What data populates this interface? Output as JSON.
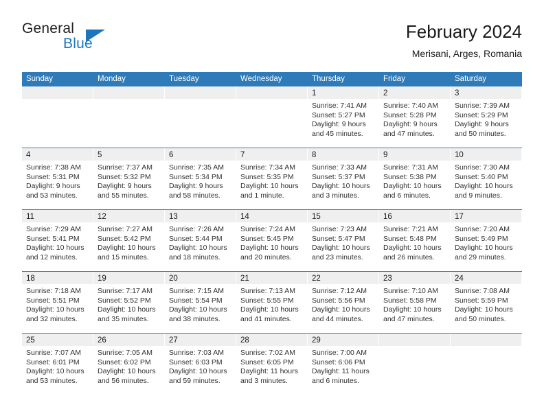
{
  "brand": {
    "name_top": "General",
    "name_bottom": "Blue",
    "triangle_icon": "blue-triangle-icon",
    "accent_color": "#1b76bc"
  },
  "header": {
    "title": "February 2024",
    "subtitle": "Merisani, Arges, Romania"
  },
  "colors": {
    "header_blue": "#2f7ab8",
    "day_head_gray": "#efeff0",
    "text": "#303030"
  },
  "weekdays": [
    "Sunday",
    "Monday",
    "Tuesday",
    "Wednesday",
    "Thursday",
    "Friday",
    "Saturday"
  ],
  "weeks": [
    [
      {
        "day": "",
        "lines": []
      },
      {
        "day": "",
        "lines": []
      },
      {
        "day": "",
        "lines": []
      },
      {
        "day": "",
        "lines": []
      },
      {
        "day": "1",
        "lines": [
          "Sunrise: 7:41 AM",
          "Sunset: 5:27 PM",
          "Daylight: 9 hours",
          "and 45 minutes."
        ]
      },
      {
        "day": "2",
        "lines": [
          "Sunrise: 7:40 AM",
          "Sunset: 5:28 PM",
          "Daylight: 9 hours",
          "and 47 minutes."
        ]
      },
      {
        "day": "3",
        "lines": [
          "Sunrise: 7:39 AM",
          "Sunset: 5:29 PM",
          "Daylight: 9 hours",
          "and 50 minutes."
        ]
      }
    ],
    [
      {
        "day": "4",
        "lines": [
          "Sunrise: 7:38 AM",
          "Sunset: 5:31 PM",
          "Daylight: 9 hours",
          "and 53 minutes."
        ]
      },
      {
        "day": "5",
        "lines": [
          "Sunrise: 7:37 AM",
          "Sunset: 5:32 PM",
          "Daylight: 9 hours",
          "and 55 minutes."
        ]
      },
      {
        "day": "6",
        "lines": [
          "Sunrise: 7:35 AM",
          "Sunset: 5:34 PM",
          "Daylight: 9 hours",
          "and 58 minutes."
        ]
      },
      {
        "day": "7",
        "lines": [
          "Sunrise: 7:34 AM",
          "Sunset: 5:35 PM",
          "Daylight: 10 hours",
          "and 1 minute."
        ]
      },
      {
        "day": "8",
        "lines": [
          "Sunrise: 7:33 AM",
          "Sunset: 5:37 PM",
          "Daylight: 10 hours",
          "and 3 minutes."
        ]
      },
      {
        "day": "9",
        "lines": [
          "Sunrise: 7:31 AM",
          "Sunset: 5:38 PM",
          "Daylight: 10 hours",
          "and 6 minutes."
        ]
      },
      {
        "day": "10",
        "lines": [
          "Sunrise: 7:30 AM",
          "Sunset: 5:40 PM",
          "Daylight: 10 hours",
          "and 9 minutes."
        ]
      }
    ],
    [
      {
        "day": "11",
        "lines": [
          "Sunrise: 7:29 AM",
          "Sunset: 5:41 PM",
          "Daylight: 10 hours",
          "and 12 minutes."
        ]
      },
      {
        "day": "12",
        "lines": [
          "Sunrise: 7:27 AM",
          "Sunset: 5:42 PM",
          "Daylight: 10 hours",
          "and 15 minutes."
        ]
      },
      {
        "day": "13",
        "lines": [
          "Sunrise: 7:26 AM",
          "Sunset: 5:44 PM",
          "Daylight: 10 hours",
          "and 18 minutes."
        ]
      },
      {
        "day": "14",
        "lines": [
          "Sunrise: 7:24 AM",
          "Sunset: 5:45 PM",
          "Daylight: 10 hours",
          "and 20 minutes."
        ]
      },
      {
        "day": "15",
        "lines": [
          "Sunrise: 7:23 AM",
          "Sunset: 5:47 PM",
          "Daylight: 10 hours",
          "and 23 minutes."
        ]
      },
      {
        "day": "16",
        "lines": [
          "Sunrise: 7:21 AM",
          "Sunset: 5:48 PM",
          "Daylight: 10 hours",
          "and 26 minutes."
        ]
      },
      {
        "day": "17",
        "lines": [
          "Sunrise: 7:20 AM",
          "Sunset: 5:49 PM",
          "Daylight: 10 hours",
          "and 29 minutes."
        ]
      }
    ],
    [
      {
        "day": "18",
        "lines": [
          "Sunrise: 7:18 AM",
          "Sunset: 5:51 PM",
          "Daylight: 10 hours",
          "and 32 minutes."
        ]
      },
      {
        "day": "19",
        "lines": [
          "Sunrise: 7:17 AM",
          "Sunset: 5:52 PM",
          "Daylight: 10 hours",
          "and 35 minutes."
        ]
      },
      {
        "day": "20",
        "lines": [
          "Sunrise: 7:15 AM",
          "Sunset: 5:54 PM",
          "Daylight: 10 hours",
          "and 38 minutes."
        ]
      },
      {
        "day": "21",
        "lines": [
          "Sunrise: 7:13 AM",
          "Sunset: 5:55 PM",
          "Daylight: 10 hours",
          "and 41 minutes."
        ]
      },
      {
        "day": "22",
        "lines": [
          "Sunrise: 7:12 AM",
          "Sunset: 5:56 PM",
          "Daylight: 10 hours",
          "and 44 minutes."
        ]
      },
      {
        "day": "23",
        "lines": [
          "Sunrise: 7:10 AM",
          "Sunset: 5:58 PM",
          "Daylight: 10 hours",
          "and 47 minutes."
        ]
      },
      {
        "day": "24",
        "lines": [
          "Sunrise: 7:08 AM",
          "Sunset: 5:59 PM",
          "Daylight: 10 hours",
          "and 50 minutes."
        ]
      }
    ],
    [
      {
        "day": "25",
        "lines": [
          "Sunrise: 7:07 AM",
          "Sunset: 6:01 PM",
          "Daylight: 10 hours",
          "and 53 minutes."
        ]
      },
      {
        "day": "26",
        "lines": [
          "Sunrise: 7:05 AM",
          "Sunset: 6:02 PM",
          "Daylight: 10 hours",
          "and 56 minutes."
        ]
      },
      {
        "day": "27",
        "lines": [
          "Sunrise: 7:03 AM",
          "Sunset: 6:03 PM",
          "Daylight: 10 hours",
          "and 59 minutes."
        ]
      },
      {
        "day": "28",
        "lines": [
          "Sunrise: 7:02 AM",
          "Sunset: 6:05 PM",
          "Daylight: 11 hours",
          "and 3 minutes."
        ]
      },
      {
        "day": "29",
        "lines": [
          "Sunrise: 7:00 AM",
          "Sunset: 6:06 PM",
          "Daylight: 11 hours",
          "and 6 minutes."
        ]
      },
      {
        "day": "",
        "lines": []
      },
      {
        "day": "",
        "lines": []
      }
    ]
  ]
}
